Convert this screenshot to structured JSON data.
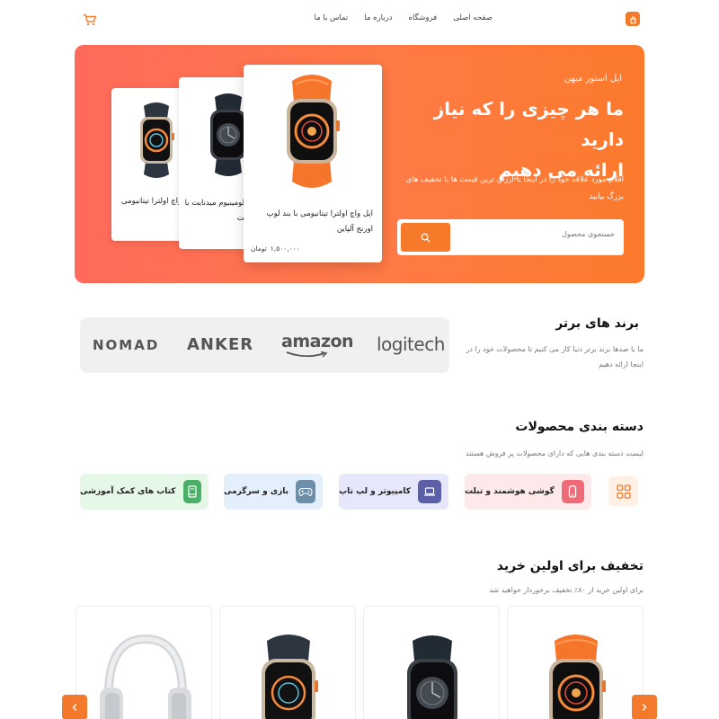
{
  "header": {
    "logo_icon": "shopping-bag-icon",
    "nav": [
      "صفحه اصلی",
      "فروشگاه",
      "درباره ما",
      "تماس با ما"
    ],
    "cart_icon": "cart-icon",
    "accent": "#f47a2b"
  },
  "hero": {
    "subtitle": "اپل استور میهن",
    "title_line1": "ما هر چیزی را که نیاز دارید",
    "title_line2": "ارائه می دهیم",
    "description": "اقلام مورد علاقه خود را در اینجا با ارزان ترین قیمت ها با تخفیف های بزرگ بیابید",
    "search_placeholder": "جستجوی محصول",
    "search_icon": "search-icon",
    "cards": [
      {
        "name": "اپل واچ اولترا تیتانیومی با بند لوپ اورنج آلپاین",
        "price": "۱,۵۰۰,۰۰۰",
        "currency": "تومان"
      },
      {
        "name": "اپل واچ آلومینیوم میدنایت با بند میدنایت",
        "price": "",
        "currency": ""
      },
      {
        "name": "اپل واچ اولترا تیتانیومی با بند اوشن",
        "price": "",
        "currency": ""
      }
    ]
  },
  "brands": {
    "title": "برند های برتر",
    "description": "ما با صدها برند برتر دنیا کار می کنیم تا محصولات خود را در اینجا ارائه دهیم",
    "logos": [
      "logitech",
      "amazon",
      "ANKER",
      "NOMAD"
    ]
  },
  "categories": {
    "title": "دسته بندی محصولات",
    "description": "لیست دسته بندی هایی که دارای محصولات پر فروش هستند",
    "grid_icon": "grid-icon",
    "items": [
      {
        "label": "گوشی هوشمند و تبلت",
        "icon": "phone-icon",
        "bg": "#fde8ea",
        "icon_bg": "#ef6b78"
      },
      {
        "label": "کامپیوتر و لپ تاپ",
        "icon": "laptop-icon",
        "bg": "#e6e7fb",
        "icon_bg": "#5a5fa8"
      },
      {
        "label": "بازی و سرگرمی",
        "icon": "gamepad-icon",
        "bg": "#e3f0fb",
        "icon_bg": "#6c8ea8"
      },
      {
        "label": "کتاب های کمک آموزشی",
        "icon": "book-icon",
        "bg": "#e5f7e7",
        "icon_bg": "#4caf68"
      }
    ]
  },
  "discount": {
    "title": "تخفیف برای اولین خرید",
    "description": "برای اولین خرید از ۸۰٪ تخفیف برخوردار خواهید شد",
    "prev_icon": "chevron-left-icon",
    "next_icon": "chevron-right-icon"
  }
}
